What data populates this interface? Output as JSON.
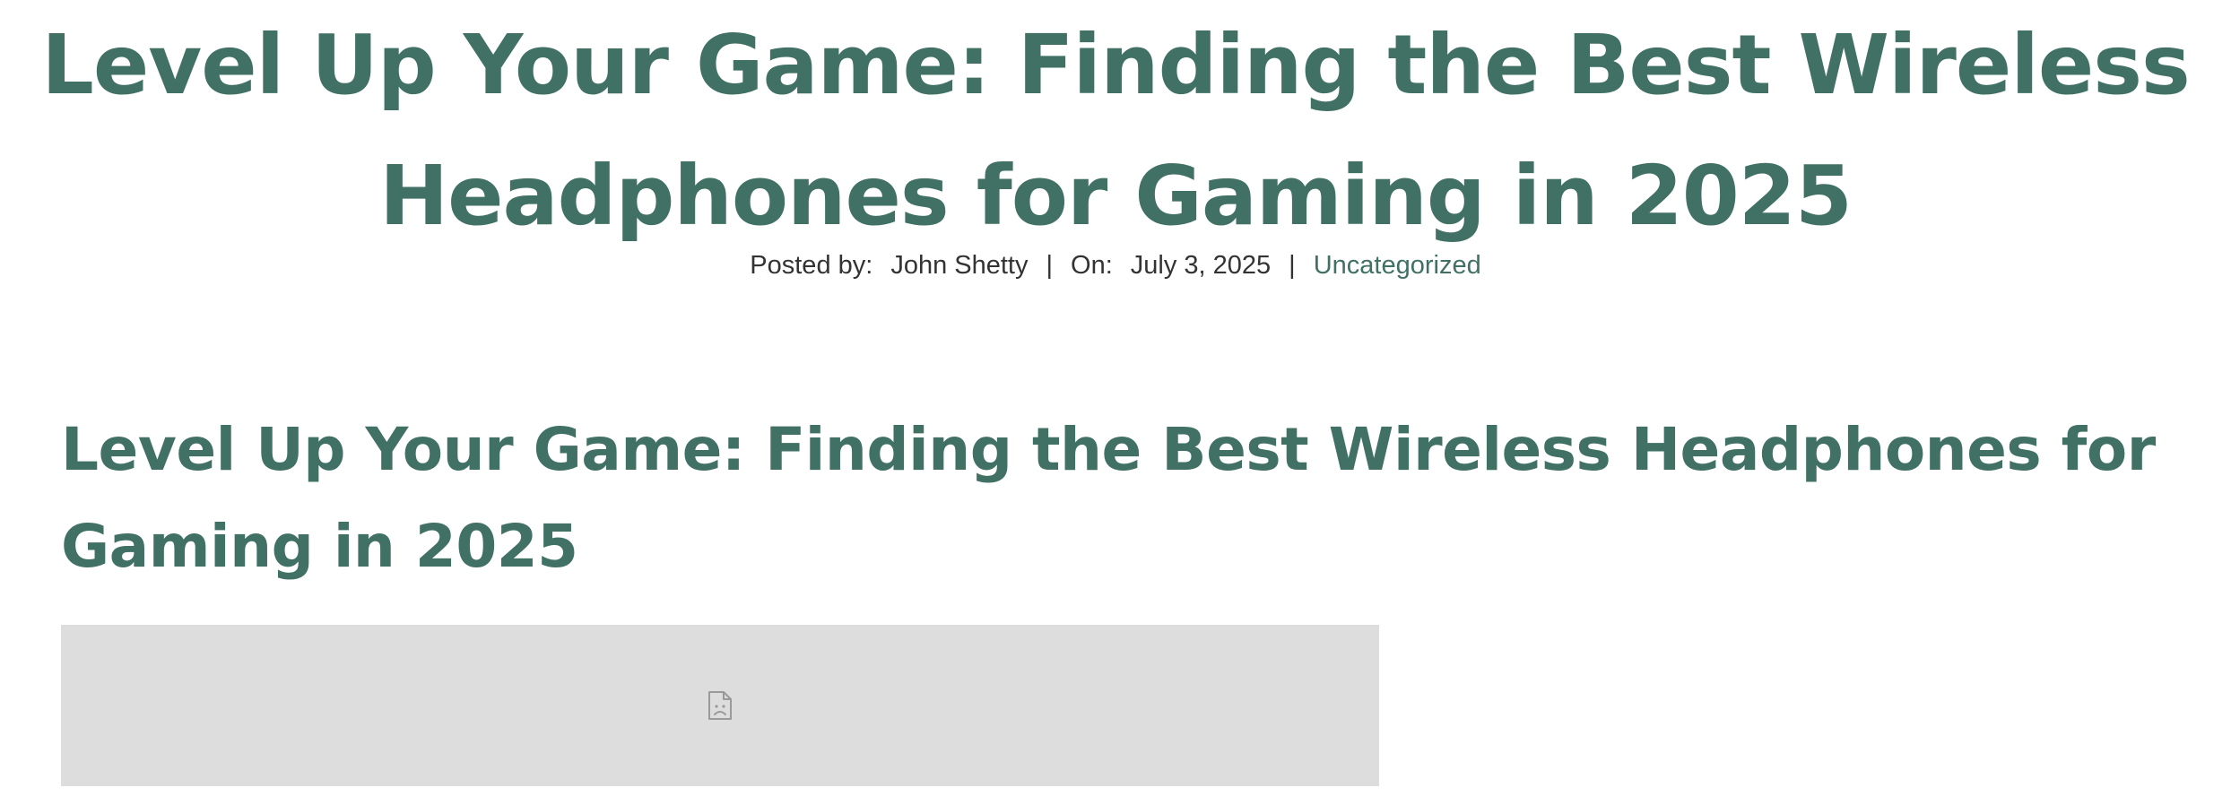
{
  "post": {
    "title_line_1": "Level Up Your Game: Finding the Best Wireless",
    "title_line_2": "Headphones for Gaming in 2025",
    "meta": {
      "posted_by_label": "Posted by:",
      "author": "John Shetty",
      "separator": "|",
      "on_label": "On:",
      "date": "July 3, 2025",
      "category": "Uncategorized"
    }
  },
  "content": {
    "heading_line_1": "Level Up Your Game: Finding the Best Wireless Headphones for",
    "heading_line_2": "Gaming in 2025",
    "image": {
      "icon": "broken-image-icon",
      "background": "#dddddd"
    }
  },
  "colors": {
    "accent": "#417164",
    "meta_text": "#333333",
    "background": "#ffffff"
  }
}
